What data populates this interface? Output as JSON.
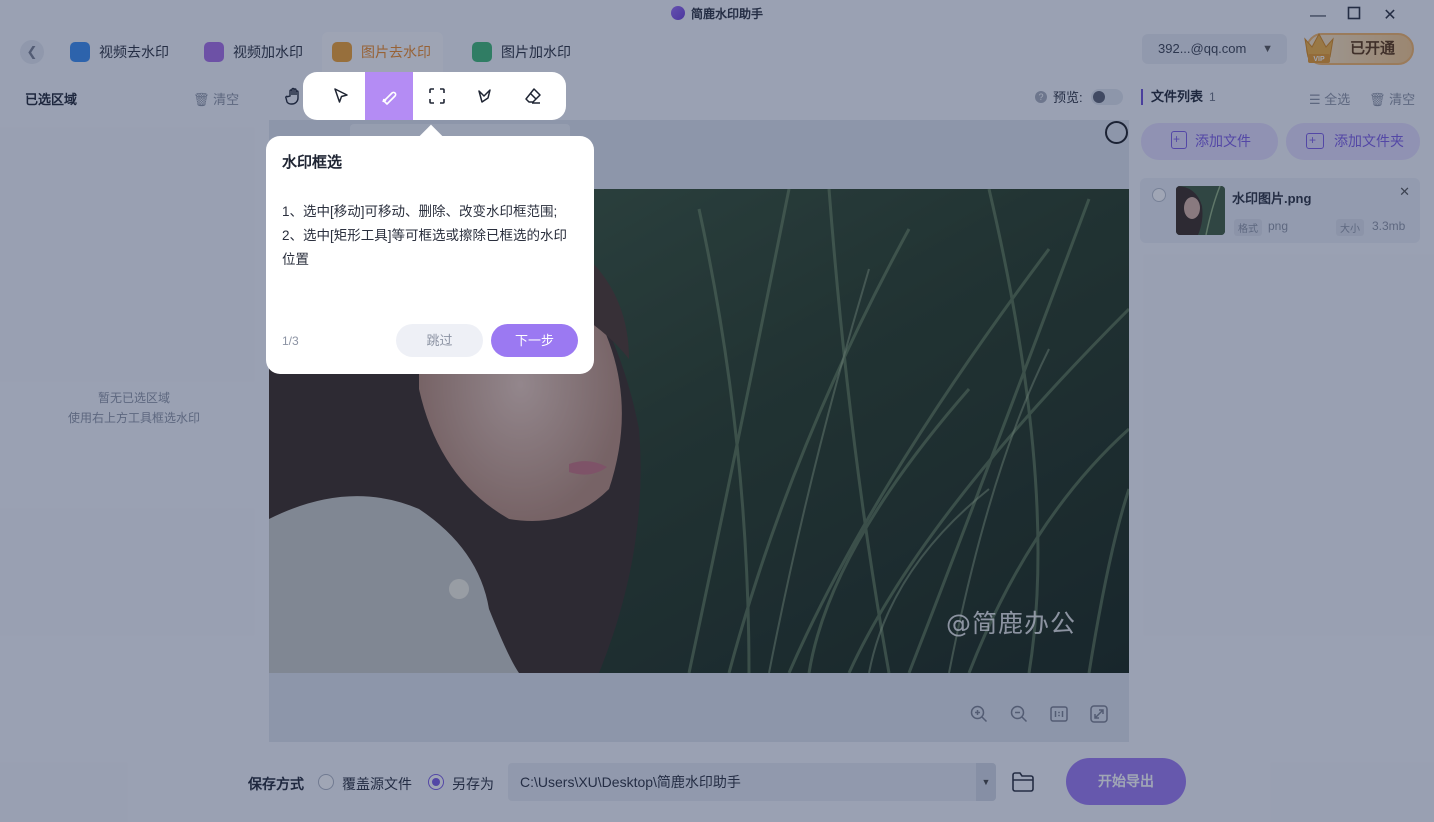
{
  "app": {
    "title": "简鹿水印助手"
  },
  "tabs": [
    {
      "label": "视频去水印",
      "icon": "video-remove-icon",
      "color": "#3a8cf0"
    },
    {
      "label": "视频加水印",
      "icon": "video-add-icon",
      "color": "#a86de6"
    },
    {
      "label": "图片去水印",
      "icon": "image-remove-icon",
      "color": "#f0a030",
      "active": true
    },
    {
      "label": "图片加水印",
      "icon": "image-add-icon",
      "color": "#3fb874"
    }
  ],
  "account": {
    "email": "392...@qq.com",
    "vip_label": "已开通",
    "vip_badge": "VIP"
  },
  "left_panel": {
    "title": "已选区域",
    "clear_label": "清空",
    "empty_line1": "暂无已选区域",
    "empty_line2": "使用右上方工具框选水印"
  },
  "toolbar": {
    "tools": [
      {
        "name": "select-arrow-icon",
        "active": false
      },
      {
        "name": "brush-icon",
        "active": true
      },
      {
        "name": "rect-select-icon",
        "active": false
      },
      {
        "name": "lasso-icon",
        "active": false
      },
      {
        "name": "eraser-icon",
        "active": false
      }
    ],
    "preview_label": "预览:",
    "preview_on": false
  },
  "canvas": {
    "watermark": "@简鹿办公",
    "zoom_tools": [
      "zoom-in-icon",
      "zoom-out-icon",
      "actual-size-icon",
      "fit-screen-icon"
    ]
  },
  "tooltip": {
    "title": "水印框选",
    "line1": "1、选中[移动]可移动、删除、改变水印框范围;",
    "line2": "2、选中[矩形工具]等可框选或擦除已框选的水印位置",
    "step": "1/3",
    "skip_label": "跳过",
    "next_label": "下一步"
  },
  "right_panel": {
    "title": "文件列表",
    "count": "1",
    "select_all_label": "全选",
    "clear_label": "清空",
    "add_file_label": "添加文件",
    "add_folder_label": "添加文件夹",
    "files": [
      {
        "name": "水印图片.png",
        "format_tag": "格式",
        "format": "png",
        "size_tag": "大小",
        "size": "3.3mb"
      }
    ]
  },
  "bottom": {
    "save_label": "保存方式",
    "overwrite_label": "覆盖源文件",
    "save_as_label": "另存为",
    "save_as_selected": true,
    "path": "C:\\Users\\XU\\Desktop\\简鹿水印助手",
    "export_label": "开始导出"
  },
  "colors": {
    "accent": "#9b79f2",
    "active_tab": "#f08b25",
    "tool_active": "#b48cf4"
  }
}
